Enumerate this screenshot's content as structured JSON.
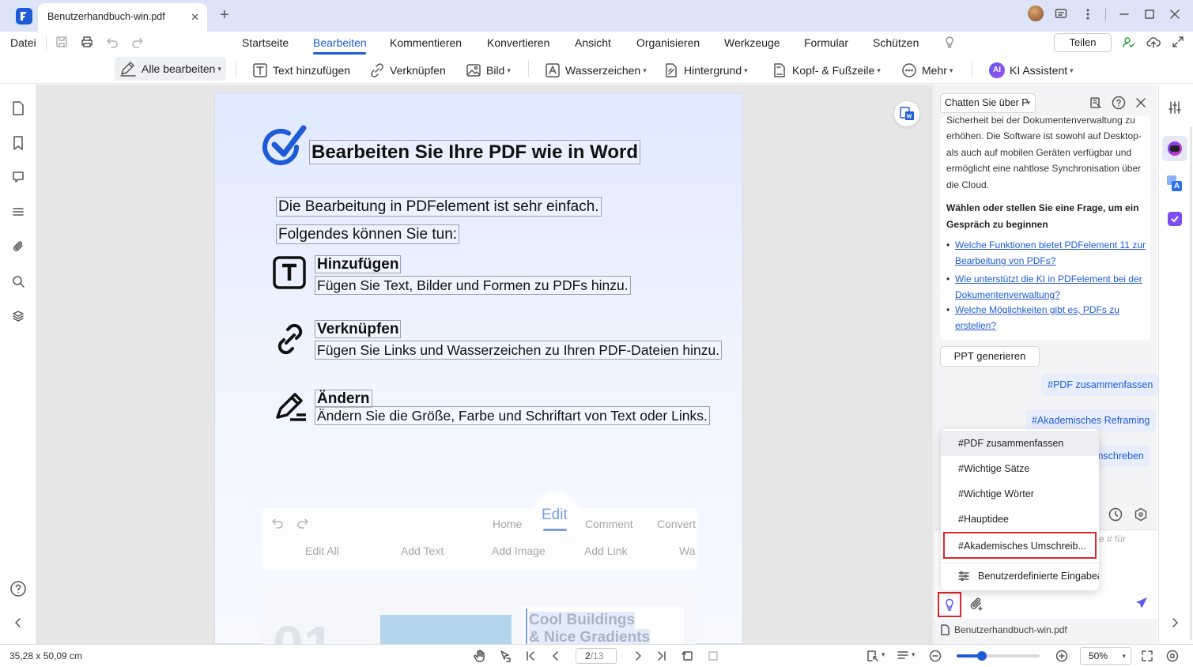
{
  "titlebar": {
    "tab_title": "Benutzerhandbuch-win.pdf",
    "close": "✕",
    "new_tab": "+"
  },
  "menu": {
    "file": "Datei",
    "tabs": [
      "Startseite",
      "Bearbeiten",
      "Kommentieren",
      "Konvertieren",
      "Ansicht",
      "Organisieren",
      "Werkzeuge",
      "Formular",
      "Schützen"
    ],
    "share": "Teilen"
  },
  "toolbar": {
    "edit_all": "Alle bearbeiten",
    "add_text": "Text hinzufügen",
    "link": "Verknüpfen",
    "image": "Bild",
    "watermark": "Wasserzeichen",
    "background": "Hintergrund",
    "header_footer": "Kopf- & Fußzeile",
    "more": "Mehr",
    "ai": "KI Assistent"
  },
  "document": {
    "title": "Bearbeiten Sie Ihre PDF wie in Word",
    "intro1": "Die Bearbeitung in PDFelement ist sehr einfach.",
    "intro2": "Folgendes können Sie tun:",
    "f1_title": "Hinzufügen",
    "f1_desc": "Fügen Sie Text, Bilder und Formen zu PDFs hinzu.",
    "f2_title": "Verknüpfen",
    "f2_desc": "Fügen Sie Links und Wasserzeichen zu Ihren PDF-Dateien hinzu.",
    "f3_title": "Ändern",
    "f3_desc": "Ändern Sie die Größe, Farbe und Schriftart von Text oder Links.",
    "preview": {
      "tabs": [
        "Home",
        "Edit",
        "Comment",
        "Convert"
      ],
      "tools": [
        "Edit All",
        "Add Text",
        "Add Image",
        "Add Link",
        "Wa"
      ],
      "card": [
        "Cool Buildings",
        "& Nice Gradients"
      ]
    }
  },
  "chat": {
    "header": "Chatten Sie über P",
    "answer": "Sicherheit bei der Dokumentenverwaltung zu erhöhen. Die Software ist sowohl auf Desktop- als auch auf mobilen Geräten verfügbar und ermöglicht eine nahtlose Synchronisation über die Cloud.",
    "prompt_heading": "Wählen oder stellen Sie eine Frage, um ein Gespräch zu beginnen",
    "questions": [
      "Welche Funktionen bietet PDFelement 11 zur Bearbeitung von PDFs?",
      "Wie unterstützt die KI in PDFelement bei der Dokumentenverwaltung?",
      "Welche Möglichkeiten gibt es, PDFs zu erstellen?"
    ],
    "ppt_button": "PPT generieren",
    "chip1": "#PDF zusammenfassen",
    "chip2": "#Akademisches Reframing",
    "chip3": "mschreben",
    "input_hint": "e # für",
    "file": "Benutzerhandbuch-win.pdf",
    "dropdown": [
      "#PDF zusammenfassen",
      "#Wichtige Sätze",
      "#Wichtige Wörter",
      "#Hauptidee",
      "#Akademisches Umschreib..."
    ],
    "dropdown_custom": "Benutzerdefinierte Eingabeau"
  },
  "status": {
    "dimensions": "35,28 x 50,09 cm",
    "page": "2",
    "page_total": "/13",
    "zoom": "50%"
  },
  "colors": {
    "accent": "#1f5bd6",
    "highlight": "#e0262a",
    "link": "#1f5bd6"
  }
}
